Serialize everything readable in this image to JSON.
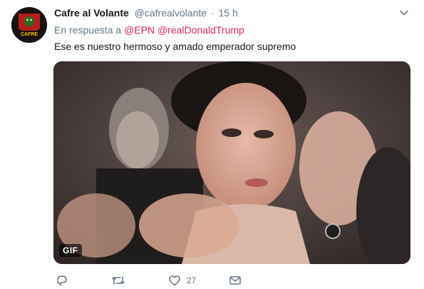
{
  "tweet": {
    "display_name": "Cafre al Volante",
    "handle": "@cafrealvolante",
    "separator": "·",
    "timestamp": "15 h",
    "reply_prefix": "En respuesta a",
    "reply_mentions": [
      "@EPN",
      "@realDonaldTrump"
    ],
    "text": "Ese es nuestro hermoso y amado emperador supremo",
    "avatar_label": "CAFRE",
    "media": {
      "type": "gif",
      "badge": "GIF"
    },
    "actions": {
      "reply": {
        "icon": "reply-icon",
        "count": ""
      },
      "retweet": {
        "icon": "retweet-icon",
        "count": ""
      },
      "like": {
        "icon": "heart-icon",
        "count": "27"
      },
      "dm": {
        "icon": "envelope-icon",
        "count": ""
      }
    }
  },
  "colors": {
    "text": "#14171a",
    "secondary": "#657786",
    "mention": "#e0245e",
    "background": "#ffffff"
  }
}
